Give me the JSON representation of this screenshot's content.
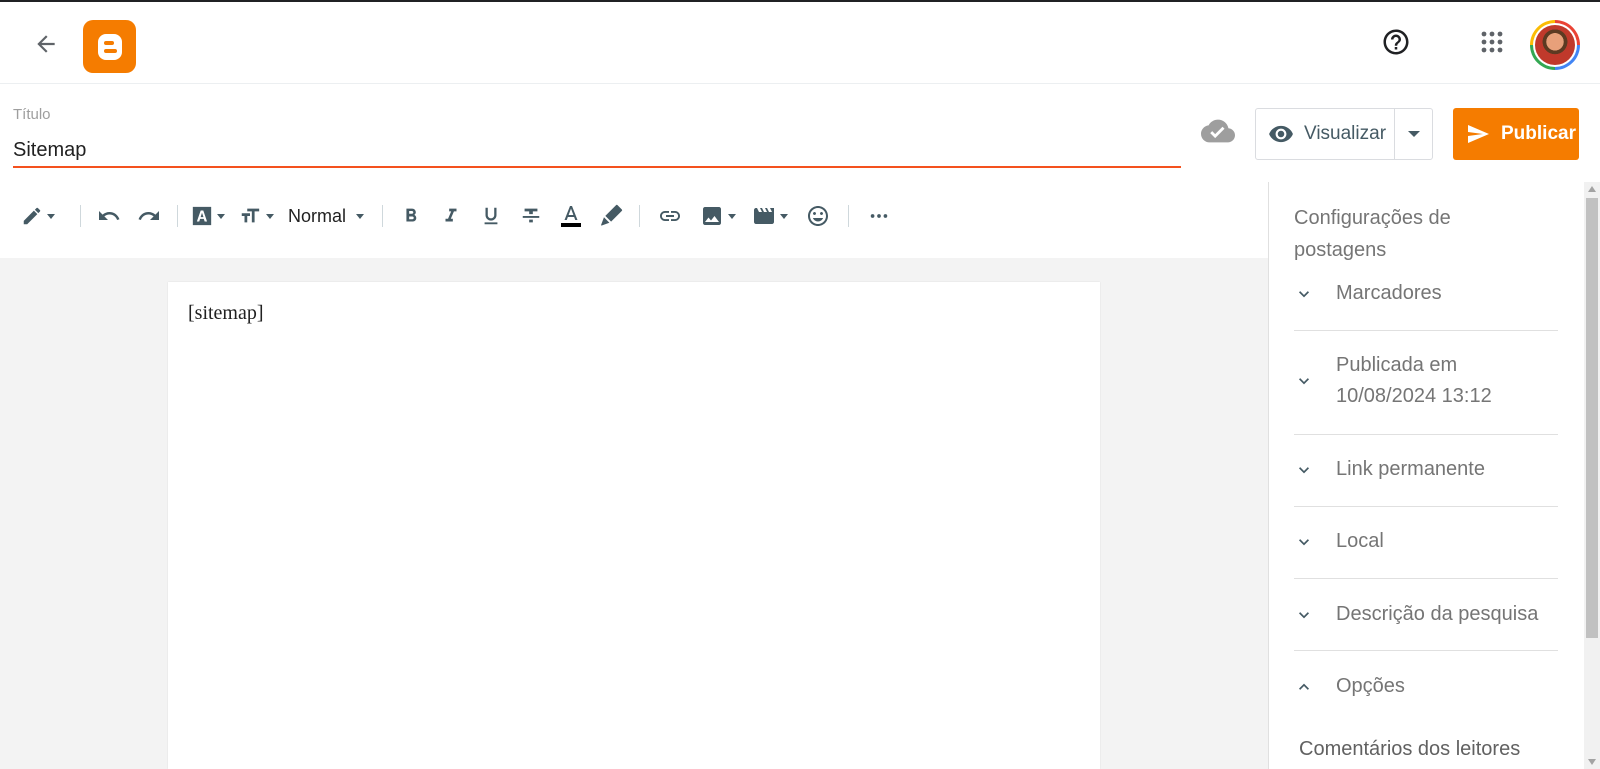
{
  "header": {
    "back_icon": "arrow-back-icon",
    "logo_icon": "blogger-logo",
    "help_icon": "help-circle-icon",
    "apps_icon": "apps-grid-icon",
    "avatar_icon": "user-avatar"
  },
  "title_field": {
    "label": "Título",
    "value": "Sitemap"
  },
  "actions": {
    "save_status_icon": "cloud-done-icon",
    "preview_label": "Visualizar",
    "publish_label": "Publicar",
    "accent_color": "#f57c00"
  },
  "toolbar": {
    "paragraph_style": "Normal",
    "icons": [
      "pencil-mode-icon",
      "undo-icon",
      "redo-icon",
      "font-icon",
      "font-size-icon",
      "bold-icon",
      "italic-icon",
      "underline-icon",
      "strikethrough-icon",
      "text-color-icon",
      "highlight-icon",
      "link-icon",
      "image-icon",
      "video-icon",
      "emoji-icon",
      "more-icon"
    ]
  },
  "editor": {
    "content": "[sitemap]"
  },
  "side_panel": {
    "title": "Configurações de postagens",
    "sections": [
      {
        "label": "Marcadores",
        "expanded": false
      },
      {
        "label": "Publicada em 10/08/2024 13:12",
        "expanded": false
      },
      {
        "label": "Link permanente",
        "expanded": false
      },
      {
        "label": "Local",
        "expanded": false
      },
      {
        "label": "Descrição da pesquisa",
        "expanded": false
      },
      {
        "label": "Opções",
        "expanded": true
      }
    ],
    "sub_label": "Comentários dos leitores"
  }
}
